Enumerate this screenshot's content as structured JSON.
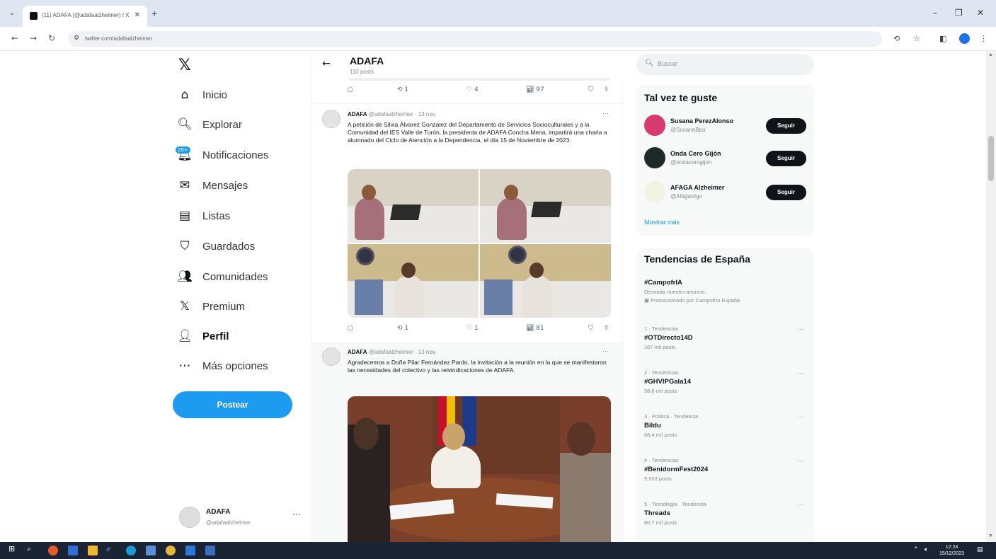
{
  "browser": {
    "tab_title": "(11) ADAFA (@adafaalzheimer) / X",
    "url": "twitter.com/adafaalzheimer"
  },
  "nav": {
    "items": [
      {
        "label": "Inicio",
        "icon": "home-icon",
        "glyph": "⌂"
      },
      {
        "label": "Explorar",
        "icon": "search-icon",
        "glyph": "🔍︎"
      },
      {
        "label": "Notificaciones",
        "icon": "bell-icon",
        "glyph": "🔔︎",
        "badge": "20+"
      },
      {
        "label": "Mensajes",
        "icon": "mail-icon",
        "glyph": "✉"
      },
      {
        "label": "Listas",
        "icon": "list-icon",
        "glyph": "▤"
      },
      {
        "label": "Guardados",
        "icon": "bookmark-icon",
        "glyph": "⛉"
      },
      {
        "label": "Comunidades",
        "icon": "communities-icon",
        "glyph": "👥︎"
      },
      {
        "label": "Premium",
        "icon": "x-premium-icon",
        "glyph": "𝕏"
      },
      {
        "label": "Perfil",
        "icon": "person-icon",
        "glyph": "👤︎"
      },
      {
        "label": "Más opciones",
        "icon": "more-circle-icon",
        "glyph": "⋯"
      }
    ],
    "post_button": "Postear",
    "account": {
      "name": "ADAFA",
      "handle": "@adafaalzheimer"
    }
  },
  "profile_header": {
    "title": "ADAFA",
    "subtitle": "110 posts"
  },
  "top_actions": {
    "replies": "",
    "retweets": "1",
    "likes": "4",
    "views": "97"
  },
  "tweets": [
    {
      "name": "ADAFA",
      "handle": "@adafaalzheimer",
      "time": "· 13 nov.",
      "text": "A petición de Silvia Álvarez Gonzalez del Departamento de Servicios Socioculturales y a la Comunidad del IES Valle de Turón, la presidenta de ADAFA Concha Mena, impartirá una charla a alumnado del Ciclo de Atención a la Dependencia, el día 15 de Noviembre de 2023.",
      "replies": "",
      "retweets": "1",
      "likes": "1",
      "views": "81"
    },
    {
      "name": "ADAFA",
      "handle": "@adafaalzheimer",
      "time": "· 13 nov.",
      "text": "Agradecemos a Doña Pilar Fernández Pardo, la invitación a la reunión en la que se manifestaron las necesidades del colectivo y las reivindicaciones de ADAFA."
    }
  ],
  "search": {
    "placeholder": "Buscar"
  },
  "suggestions": {
    "title": "Tal vez te guste",
    "follow_label": "Seguir",
    "show_more": "Mostrar más",
    "items": [
      {
        "name": "Susana PerezAlonso",
        "handle": "@SusanaBpa"
      },
      {
        "name": "Onda Cero Gijón",
        "handle": "@ondacerogijon"
      },
      {
        "name": "AFAGA Alzheimer",
        "handle": "@AfagaVigo"
      }
    ]
  },
  "trends": {
    "title": "Tendencias de España",
    "promoted": {
      "name": "#CampofrIA",
      "desc": "Desnuda nuestro anuncio.",
      "meta": "Promocionado por Campofrío España"
    },
    "items": [
      {
        "meta": "1 · Tendencias",
        "name": "#OTDirecto14D",
        "count": "107 mil posts"
      },
      {
        "meta": "2 · Tendencias",
        "name": "#GHVIPGala14",
        "count": "58,8 mil posts"
      },
      {
        "meta": "3 · Política · Tendencia",
        "name": "Bildu",
        "count": "68,4 mil posts"
      },
      {
        "meta": "4 · Tendencias",
        "name": "#BenidormFest2024",
        "count": "9.933 posts"
      },
      {
        "meta": "5 · Tecnología · Tendencia",
        "name": "Threads",
        "count": "80,7 mil posts"
      }
    ]
  },
  "taskbar": {
    "time": "12:24",
    "date": "15/12/2023"
  }
}
